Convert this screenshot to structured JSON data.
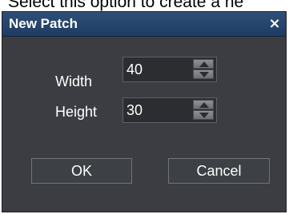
{
  "caption": "Select this option to create a ne",
  "dialog": {
    "title": "New Patch",
    "close_glyph": "×",
    "fields": {
      "width": {
        "label": "Width",
        "value": "40"
      },
      "height": {
        "label": "Height",
        "value": "30"
      }
    },
    "buttons": {
      "ok": "OK",
      "cancel": "Cancel"
    }
  },
  "icons": {
    "close": "close-icon",
    "spin_up": "up-arrow-icon",
    "spin_down": "down-arrow-icon"
  },
  "colors": {
    "title_bar": "#1e3c63",
    "dialog_background": "#3b3d42",
    "text": "#ffffff"
  }
}
